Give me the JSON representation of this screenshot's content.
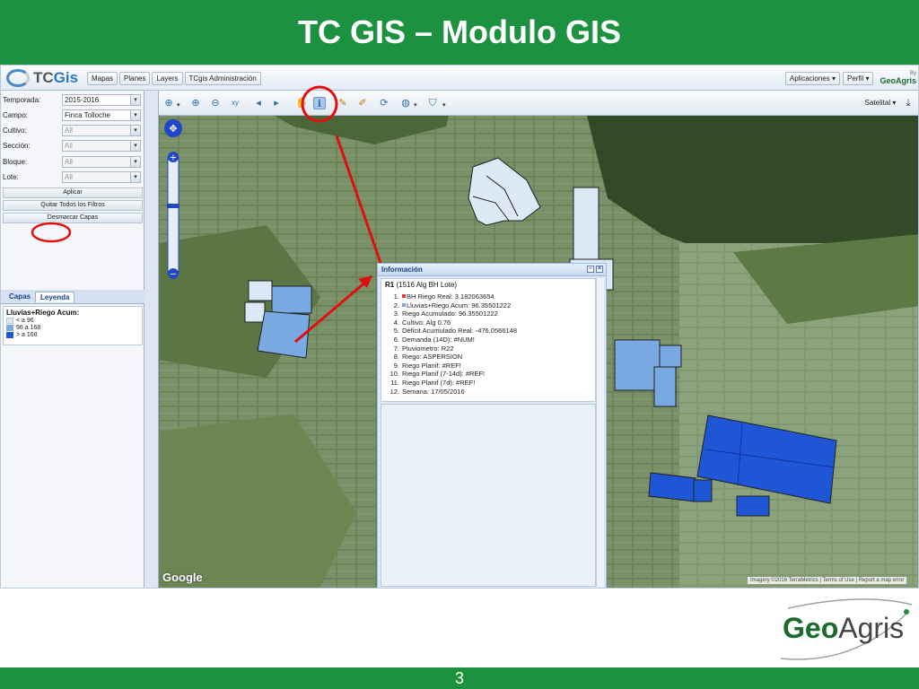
{
  "slide": {
    "title": "TC GIS – Modulo GIS",
    "page_number": "3"
  },
  "app": {
    "logo_text_a": "TC",
    "logo_text_b": "Gis",
    "nav": [
      "Mapas",
      "Planes",
      "Layers",
      "TCgis Administración"
    ],
    "top_right": [
      "Aplicaciones ▾",
      "Perfil ▾"
    ],
    "brand_by": "By",
    "brand_name": "GeoAgris"
  },
  "filters": [
    {
      "label": "Temporada:",
      "value": "2015-2016",
      "disabled": false
    },
    {
      "label": "Campo:",
      "value": "Finca Tolloche",
      "disabled": false
    },
    {
      "label": "Cultivo:",
      "value": "All",
      "disabled": true
    },
    {
      "label": "Sección:",
      "value": "All",
      "disabled": true
    },
    {
      "label": "Bloque:",
      "value": "All",
      "disabled": true
    },
    {
      "label": "Lote:",
      "value": "All",
      "disabled": true
    }
  ],
  "panel_buttons": [
    "Aplicar",
    "Quitar Todos los Filtros",
    "Desmarcar Capas"
  ],
  "tabs": [
    "Capas",
    "Leyenda"
  ],
  "legend": {
    "title": "Lluvias+Riego Acum:",
    "items": [
      {
        "label": "< a 96",
        "color": "#dce8f5"
      },
      {
        "label": "96 a 168",
        "color": "#78a9e0"
      },
      {
        "label": "> a 168",
        "color": "#1f56d6"
      }
    ]
  },
  "map_toolbar": {
    "basemap": "Satelital ▾"
  },
  "info_window": {
    "title": "Información",
    "record_id": "R1",
    "record_desc": "(1516 Alg BH Lote)",
    "lines": [
      {
        "n": "1.",
        "text": "BH Riego Real: 3.182063654",
        "dot": "#e23b3b"
      },
      {
        "n": "2.",
        "text": "Lluvias+Riego Acum: 96.35501222",
        "dot": "#78a9e0"
      },
      {
        "n": "3.",
        "text": "Riego Acumulado: 96.35501222",
        "dot": ""
      },
      {
        "n": "4.",
        "text": "Cultivo: Alg 0.76",
        "dot": ""
      },
      {
        "n": "5.",
        "text": "Déficit Acumulado Real: -476.0566148",
        "dot": ""
      },
      {
        "n": "6.",
        "text": "Demanda (14D): #NUM!",
        "dot": ""
      },
      {
        "n": "7.",
        "text": "Pluviometro: R22",
        "dot": ""
      },
      {
        "n": "8.",
        "text": "Riego: ASPERSION",
        "dot": ""
      },
      {
        "n": "9.",
        "text": "Riego Planif: #REF!",
        "dot": ""
      },
      {
        "n": "10.",
        "text": "Riego Planif (7-14d): #REF!",
        "dot": ""
      },
      {
        "n": "11.",
        "text": "Riego Planif (7d): #REF!",
        "dot": ""
      },
      {
        "n": "12.",
        "text": "Semana: 17/05/2016",
        "dot": ""
      }
    ]
  },
  "map_footer": {
    "google": "Google",
    "imagery": "Imagery ©2016 TerraMetrics",
    "terms": "Terms of Use",
    "report": "Report a map error"
  },
  "colors": {
    "green": "#1c9140",
    "annotation_red": "#e01010"
  }
}
